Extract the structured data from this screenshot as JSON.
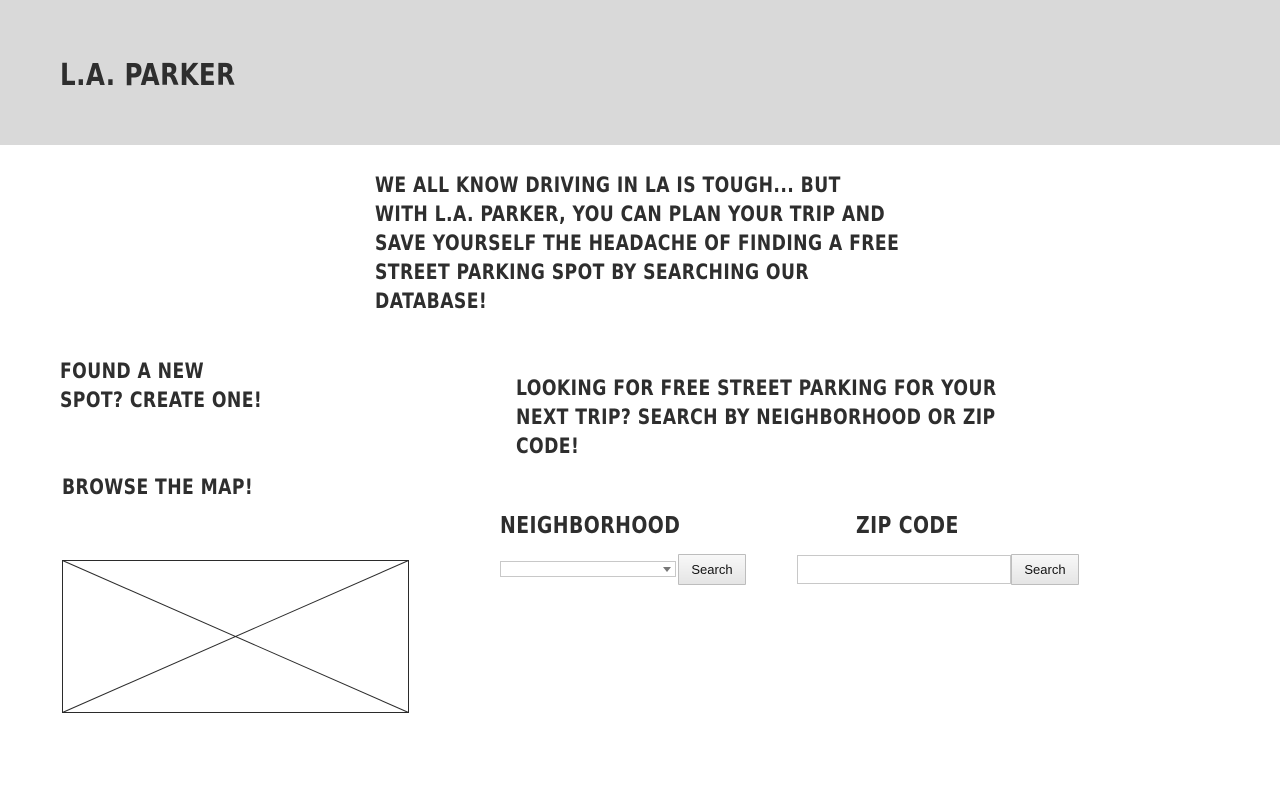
{
  "header": {
    "logo": "L.A. PARKER"
  },
  "intro": {
    "text": "We all know driving in LA is tough... but with L.A. parker, you can plan your trip and save yourself the headache of finding a free street parking spot by searching our database!"
  },
  "create_spot": {
    "text": "Found a new spot? Create one!"
  },
  "browse": {
    "heading": "Browse the map!",
    "map_placeholder": "map-image-placeholder"
  },
  "search": {
    "intro": "Looking for free street parking for your next trip? Search by neighborhood or zip code!",
    "neighborhood": {
      "label": "Neighborhood",
      "selected_value": "",
      "button_label": "Search"
    },
    "zip": {
      "label": "Zip code",
      "value": "",
      "placeholder": "",
      "button_label": "Search"
    }
  },
  "colors": {
    "header_bg": "#d9d9d9",
    "text": "#2e2e2e",
    "page_bg": "#ffffff"
  }
}
